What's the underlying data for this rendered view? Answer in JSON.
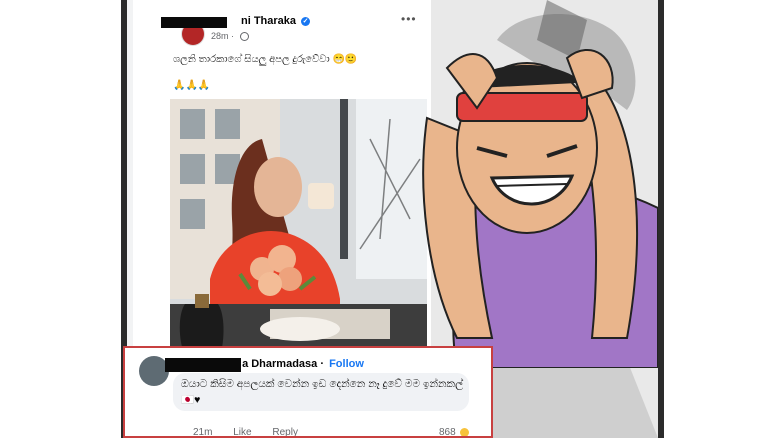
{
  "post": {
    "author_name": "ni Tharaka",
    "timestamp": "28m",
    "text": "ශලනි තාරකාගේ සියලු අපල දුරුවේවා 😁🙂",
    "emoji_line": "🙏🙏🙏",
    "more_label": "•••"
  },
  "comment": {
    "author_name": "a Dharmadasa",
    "separator": "·",
    "follow_label": "Follow",
    "text": "ඔයාට කිසිම අපලයක් වෙන්න ඉඩ දෙන්නෙ නෑ දුවේ මම ඉන්නකල් 🇯🇵♥",
    "time": "21m",
    "like_label": "Like",
    "reply_label": "Reply",
    "reaction_count": "868"
  },
  "colors": {
    "accent": "#1877f2",
    "highlight_border": "#c84040",
    "headband": "#e0413e",
    "shirt": "#a176c6",
    "skin": "#e9b58c"
  }
}
